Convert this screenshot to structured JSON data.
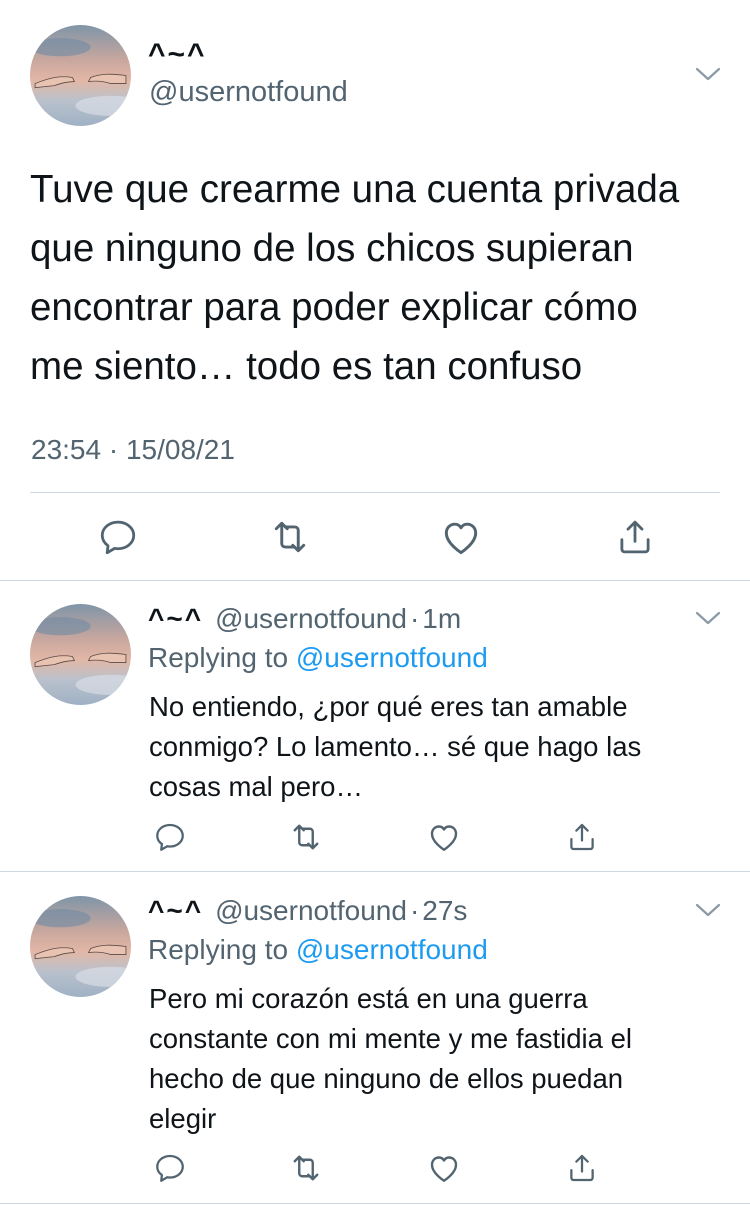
{
  "main_tweet": {
    "display_name": "^~^",
    "handle": "@usernotfound",
    "text": "Tuve que crearme una cuenta privada\nque ninguno de los chicos supieran\nencontrar para poder explicar cómo\nme siento… todo es tan confuso",
    "timestamp": "23:54 · 15/08/21",
    "actions": [
      "reply-icon",
      "retweet-icon",
      "like-icon",
      "share-icon"
    ]
  },
  "replies": [
    {
      "display_name": "^~^",
      "handle": "@usernotfound",
      "separator": "·",
      "time_ago": "1m",
      "replying_prefix": "Replying to",
      "replying_to": "@usernotfound",
      "text": "No entiendo, ¿por qué eres tan amable\nconmigo? Lo lamento… sé que hago las\ncosas mal pero…"
    },
    {
      "display_name": "^~^",
      "handle": "@usernotfound",
      "separator": "·",
      "time_ago": "27s",
      "replying_prefix": "Replying to",
      "replying_to": "@usernotfound",
      "text": "Pero mi corazón está en una guerra\nconstante con mi mente y me fastidia el\nhecho de que ninguno de ellos puedan\nelegir"
    }
  ],
  "colors": {
    "text": "#0f1419",
    "secondary": "#536471",
    "link": "#1d9bf0",
    "divider": "#cfd9de"
  }
}
